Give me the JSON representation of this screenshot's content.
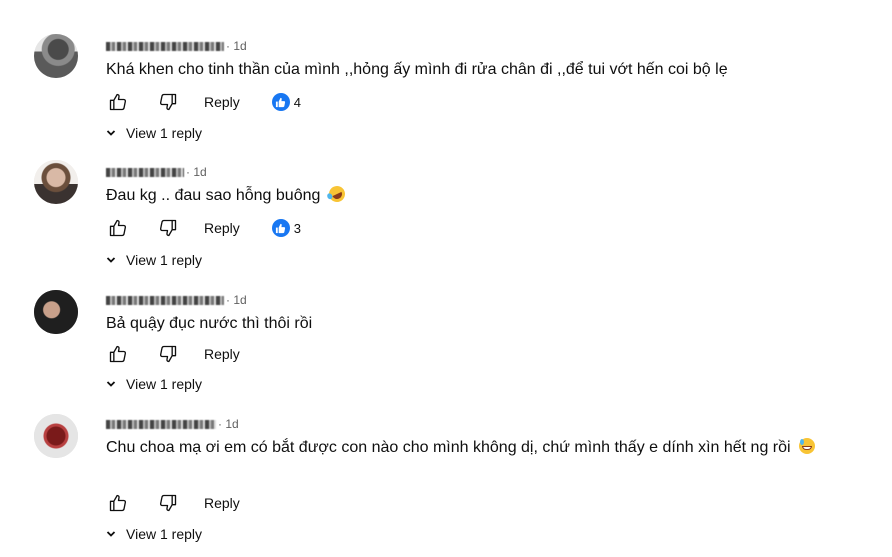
{
  "comments": [
    {
      "time": "· 1d",
      "text": "Khá khen cho tinh thần của mình ,,hỏng ấy mình đi rửa chân đi ,,để tui vớt hến coi bộ lẹ",
      "emoji": "",
      "reply_label": "Reply",
      "reaction_count": "4",
      "view_replies": "View 1 reply"
    },
    {
      "time": "· 1d",
      "text": "Đau kg .. đau sao hỗng buông",
      "emoji": "rofl-emoji",
      "reply_label": "Reply",
      "reaction_count": "3",
      "view_replies": "View 1 reply"
    },
    {
      "time": "· 1d",
      "text": "Bả quậy đục nước thì thôi rồi",
      "emoji": "",
      "reply_label": "Reply",
      "reaction_count": "",
      "view_replies": "View 1 reply"
    },
    {
      "time": "· 1d",
      "text": "Chu choa mạ ơi em có bắt được con nào cho mình không dị, chứ mình thấy e dính xìn hết ng rồi",
      "emoji": "sweat-smile-emoji",
      "reply_label": "Reply",
      "reaction_count": "",
      "view_replies": "View 1 reply"
    }
  ],
  "icons": {
    "like": "thumbs-up-outline-icon",
    "dislike": "thumbs-down-outline-icon",
    "reaction": "facebook-like-badge-icon",
    "expand": "chevron-down-icon"
  },
  "colors": {
    "reaction_badge": "#1877f2",
    "meta_text": "#606060",
    "text": "#0f0f0f"
  }
}
